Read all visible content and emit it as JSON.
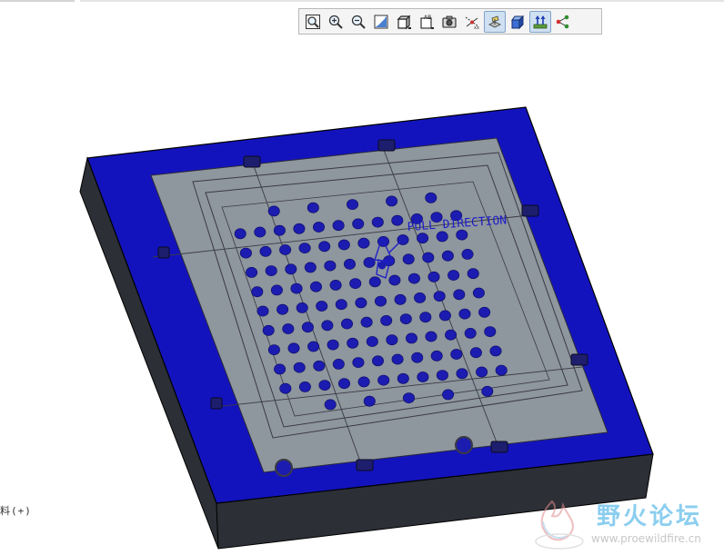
{
  "toolbar": {
    "buttons": [
      {
        "name": "refit",
        "icon": "zoom-fit-icon",
        "active": false
      },
      {
        "name": "zoom-in",
        "icon": "zoom-in-icon",
        "active": false
      },
      {
        "name": "zoom-out",
        "icon": "zoom-out-icon",
        "active": false
      },
      {
        "name": "repaint",
        "icon": "repaint-icon",
        "active": false
      },
      {
        "name": "saved-orientations",
        "icon": "orientation-cube-icon",
        "active": false
      },
      {
        "name": "named-views",
        "icon": "named-view-icon",
        "active": false
      },
      {
        "name": "display-style",
        "icon": "camera-icon",
        "active": false
      },
      {
        "name": "datum-axes",
        "icon": "datum-axis-icon",
        "active": false
      },
      {
        "name": "datum-planes",
        "icon": "datum-plane-icon",
        "active": true
      },
      {
        "name": "shaded-view",
        "icon": "shaded-box-icon",
        "active": false
      },
      {
        "name": "datum-display",
        "icon": "datum-display-icon",
        "active": true
      },
      {
        "name": "datum-points",
        "icon": "datum-points-icon",
        "active": false
      }
    ]
  },
  "side_text": "料(+)",
  "model": {
    "annotation": "PULL DIRECTION",
    "colors": {
      "plate_face": "#1313be",
      "plate_side": "#2c2f35",
      "plate_edge": "#000000",
      "cavity": "#8e969e",
      "hole": "#1c1cb0",
      "outline": "#3a3a44",
      "annotation": "#1c1cc8"
    }
  },
  "watermark": {
    "title": "野火论坛",
    "url": "www.proewildfire.cn"
  }
}
